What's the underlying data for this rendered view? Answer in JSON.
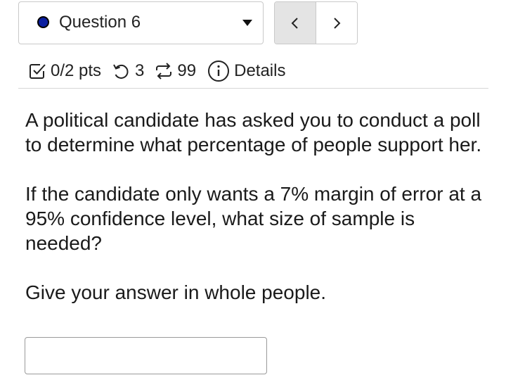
{
  "question_nav": {
    "selected_label": "Question 6",
    "status_color": "#0a1ea0",
    "caret_icon": "caret-down-icon",
    "prev_icon": "chevron-left-icon",
    "next_icon": "chevron-right-icon"
  },
  "meta": {
    "score_icon": "checkbox-icon",
    "score": "0/2 pts",
    "attempts_icon": "undo-icon",
    "attempts_remaining": "3",
    "versions_icon": "repeat-icon",
    "versions": "99",
    "details_icon": "info-icon",
    "details_label": "Details"
  },
  "question": {
    "paragraphs": [
      "A political candidate has asked you to conduct a poll to determine what percentage of people support her.",
      "If the candidate only wants a 7% margin of error at a 95% confidence level, what size of sample is needed?",
      "Give your answer in whole people."
    ],
    "answer_value": "",
    "answer_placeholder": ""
  }
}
